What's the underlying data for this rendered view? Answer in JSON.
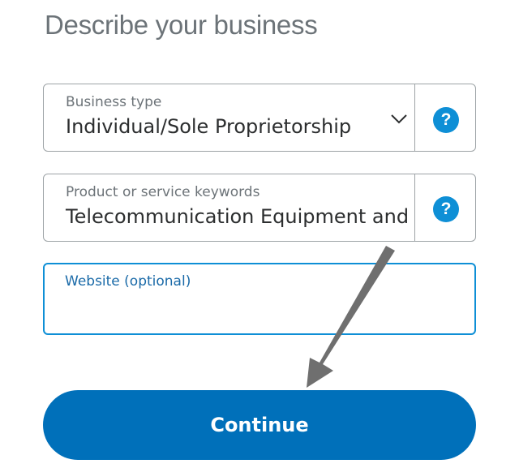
{
  "page": {
    "title": "Describe your business"
  },
  "fields": {
    "business_type": {
      "label": "Business type",
      "value": "Individual/Sole Proprietorship",
      "help_icon": "?"
    },
    "keywords": {
      "label": "Product or service keywords",
      "value": "Telecommunication Equipment and",
      "help_icon": "?"
    },
    "website": {
      "label": "Website (optional)",
      "value": ""
    }
  },
  "actions": {
    "continue_label": "Continue"
  },
  "colors": {
    "primary_button": "#0070ba",
    "focus_border": "#0e8fd6",
    "help_icon": "#0e8fd6",
    "annotation_arrow": "#6f6f6f"
  },
  "icons": {
    "dropdown": "chevron-down-icon",
    "help": "help-icon",
    "annotation": "arrow-annotation-icon"
  }
}
